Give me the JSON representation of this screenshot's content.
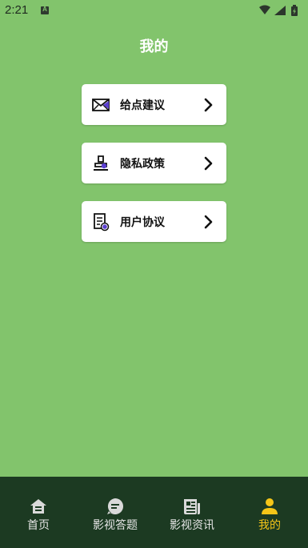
{
  "status": {
    "time": "2:21",
    "notification_letter": "A"
  },
  "header": {
    "title": "我的"
  },
  "menu": [
    {
      "label": "给点建议",
      "icon": "mail-icon"
    },
    {
      "label": "隐私政策",
      "icon": "stamp-icon"
    },
    {
      "label": "用户协议",
      "icon": "document-icon"
    }
  ],
  "nav": {
    "items": [
      {
        "label": "首页",
        "icon": "home-icon"
      },
      {
        "label": "影视答题",
        "icon": "chat-bubble-icon"
      },
      {
        "label": "影视资讯",
        "icon": "newspaper-icon"
      },
      {
        "label": "我的",
        "icon": "person-icon"
      }
    ],
    "active_index": 3
  },
  "colors": {
    "background": "#82c46c",
    "nav_background": "#1c3a22",
    "accent": "#f5c518",
    "icon_purple": "#5b3fd1"
  }
}
